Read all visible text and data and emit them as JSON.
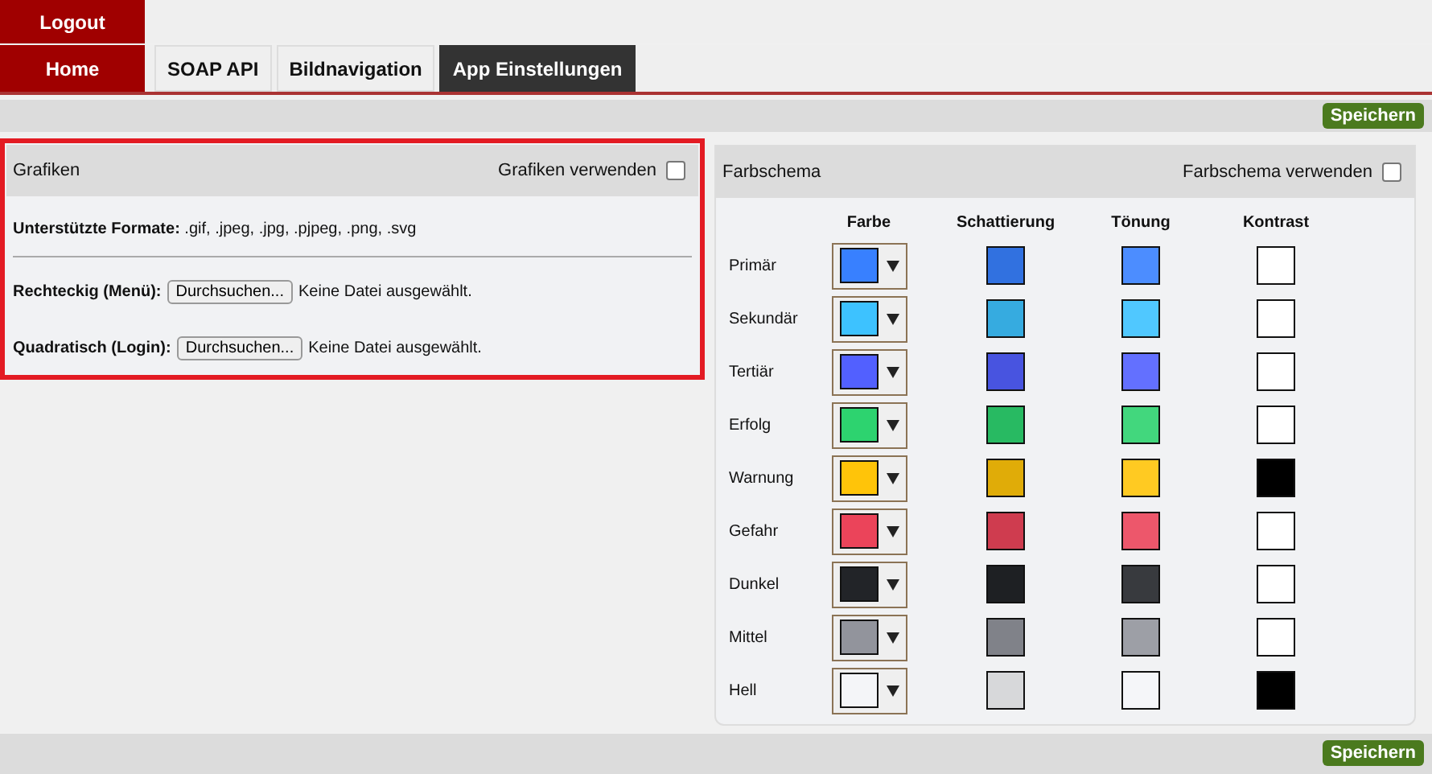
{
  "top_nav": {
    "logout": "Logout",
    "home": "Home"
  },
  "tabs": [
    {
      "label": "SOAP API",
      "selected": false
    },
    {
      "label": "Bildnavigation",
      "selected": false
    },
    {
      "label": "App Einstellungen",
      "selected": true
    }
  ],
  "save_button_top": "Speichern",
  "graphics_panel": {
    "title": "Grafiken",
    "toggle_label": "Grafiken verwenden",
    "checked": false,
    "formats_text": "**Unterstützte Formate:** .gif, .jpeg, .jpg, .pjpeg, .png, .svg",
    "uploads": [
      {
        "label": "Rechteckig (Menü):",
        "button": "Durchsuchen...",
        "status": "Keine Datei ausgewählt."
      },
      {
        "label": "Quadratisch (Login):",
        "button": "Durchsuchen...",
        "status": "Keine Datei ausgewählt."
      }
    ]
  },
  "color_panel": {
    "title": "Farbschema",
    "toggle_label": "Farbschema verwenden",
    "checked": false,
    "columns": [
      "Farbe",
      "Schattierung",
      "Tönung",
      "Kontrast"
    ],
    "rows": [
      {
        "name": "Primär",
        "swatches": [
          {
            "color": "#3880ff"
          },
          {
            "color": "#3171e0"
          },
          {
            "color": "#4c8dff"
          },
          {
            "color": "#ffffff"
          }
        ]
      },
      {
        "name": "Sekundär",
        "swatches": [
          {
            "color": "#3dc2ff"
          },
          {
            "color": "#36abe0"
          },
          {
            "color": "#50c8ff"
          },
          {
            "color": "#ffffff"
          }
        ]
      },
      {
        "name": "Tertiär",
        "swatches": [
          {
            "color": "#5260ff"
          },
          {
            "color": "#4854e0"
          },
          {
            "color": "#6370ff"
          },
          {
            "color": "#ffffff"
          }
        ]
      },
      {
        "name": "Erfolg",
        "swatches": [
          {
            "color": "#2dd36f"
          },
          {
            "color": "#28ba62"
          },
          {
            "color": "#42d77d"
          },
          {
            "color": "#ffffff"
          }
        ]
      },
      {
        "name": "Warnung",
        "swatches": [
          {
            "color": "#ffc409"
          },
          {
            "color": "#e0ac08"
          },
          {
            "color": "#ffca22"
          },
          {
            "color": "#000000"
          }
        ]
      },
      {
        "name": "Gefahr",
        "swatches": [
          {
            "color": "#eb445a"
          },
          {
            "color": "#cf3c4f"
          },
          {
            "color": "#ed576b"
          },
          {
            "color": "#ffffff"
          }
        ]
      },
      {
        "name": "Dunkel",
        "swatches": [
          {
            "color": "#222428"
          },
          {
            "color": "#1e2023"
          },
          {
            "color": "#383a3e"
          },
          {
            "color": "#ffffff"
          }
        ]
      },
      {
        "name": "Mittel",
        "swatches": [
          {
            "color": "#92949c"
          },
          {
            "color": "#808289"
          },
          {
            "color": "#9d9fa6"
          },
          {
            "color": "#ffffff"
          }
        ]
      },
      {
        "name": "Hell",
        "swatches": [
          {
            "color": "#f4f5f8"
          },
          {
            "color": "#d7d8da"
          },
          {
            "color": "#f5f6f9"
          },
          {
            "color": "#000000"
          }
        ]
      }
    ]
  },
  "save_button_bottom": "Speichern"
}
